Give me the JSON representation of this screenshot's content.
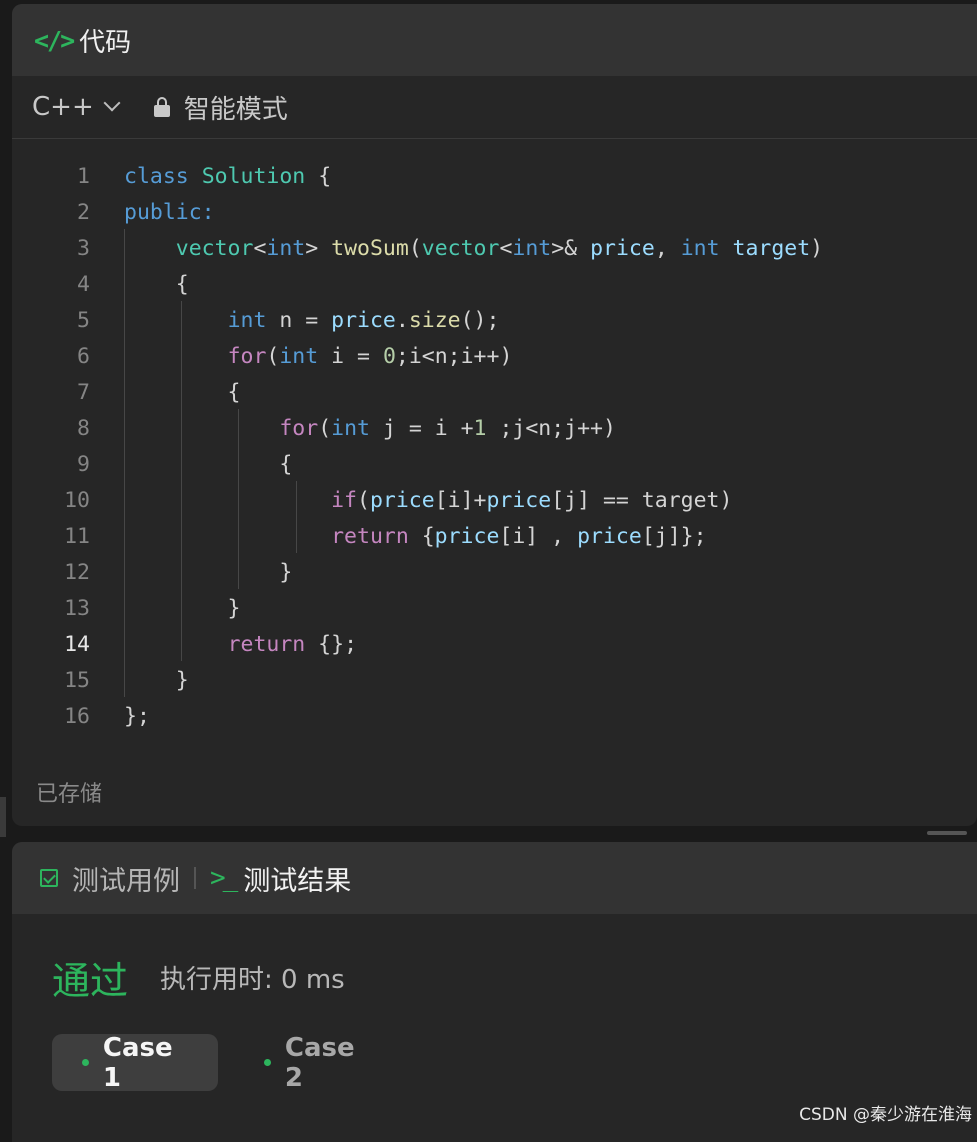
{
  "code_panel": {
    "icon": "code-icon",
    "icon_glyph": "</>",
    "title": "代码",
    "language": "C++",
    "mode": "智能模式",
    "saved_status": "已存储",
    "active_line": 14,
    "lines": [
      {
        "num": "1",
        "tokens": [
          [
            "k",
            "class"
          ],
          [
            "p",
            " "
          ],
          [
            "t",
            "Solution"
          ],
          [
            "p",
            " {"
          ]
        ]
      },
      {
        "num": "2",
        "tokens": [
          [
            "k",
            "public"
          ],
          [
            "k",
            ":"
          ]
        ]
      },
      {
        "num": "3",
        "tokens": [
          [
            "p",
            "    "
          ],
          [
            "t",
            "vector"
          ],
          [
            "p",
            "<"
          ],
          [
            "k",
            "int"
          ],
          [
            "p",
            "> "
          ],
          [
            "f",
            "twoSum"
          ],
          [
            "p",
            "("
          ],
          [
            "t",
            "vector"
          ],
          [
            "p",
            "<"
          ],
          [
            "k",
            "int"
          ],
          [
            "p",
            ">& "
          ],
          [
            "v",
            "price"
          ],
          [
            "p",
            ", "
          ],
          [
            "k",
            "int"
          ],
          [
            "p",
            " "
          ],
          [
            "v",
            "target"
          ],
          [
            "p",
            ")"
          ]
        ]
      },
      {
        "num": "4",
        "tokens": [
          [
            "p",
            "    {"
          ]
        ]
      },
      {
        "num": "5",
        "tokens": [
          [
            "p",
            "        "
          ],
          [
            "k",
            "int"
          ],
          [
            "p",
            " n = "
          ],
          [
            "v",
            "price"
          ],
          [
            "p",
            "."
          ],
          [
            "f",
            "size"
          ],
          [
            "p",
            "();"
          ]
        ]
      },
      {
        "num": "6",
        "tokens": [
          [
            "p",
            "        "
          ],
          [
            "c",
            "for"
          ],
          [
            "p",
            "("
          ],
          [
            "k",
            "int"
          ],
          [
            "p",
            " i = "
          ],
          [
            "n",
            "0"
          ],
          [
            "p",
            ";i<n;i++)"
          ]
        ]
      },
      {
        "num": "7",
        "tokens": [
          [
            "p",
            "        {"
          ]
        ]
      },
      {
        "num": "8",
        "tokens": [
          [
            "p",
            "            "
          ],
          [
            "c",
            "for"
          ],
          [
            "p",
            "("
          ],
          [
            "k",
            "int"
          ],
          [
            "p",
            " j = i +"
          ],
          [
            "n",
            "1"
          ],
          [
            "p",
            " ;j<n;j++)"
          ]
        ]
      },
      {
        "num": "9",
        "tokens": [
          [
            "p",
            "            {"
          ]
        ]
      },
      {
        "num": "10",
        "tokens": [
          [
            "p",
            "                "
          ],
          [
            "c",
            "if"
          ],
          [
            "p",
            "("
          ],
          [
            "v",
            "price"
          ],
          [
            "p",
            "[i]+"
          ],
          [
            "v",
            "price"
          ],
          [
            "p",
            "[j] == target)"
          ]
        ]
      },
      {
        "num": "11",
        "tokens": [
          [
            "p",
            "                "
          ],
          [
            "c",
            "return"
          ],
          [
            "p",
            " {"
          ],
          [
            "v",
            "price"
          ],
          [
            "p",
            "[i] , "
          ],
          [
            "v",
            "price"
          ],
          [
            "p",
            "[j]};"
          ]
        ]
      },
      {
        "num": "12",
        "tokens": [
          [
            "p",
            "            }"
          ]
        ]
      },
      {
        "num": "13",
        "tokens": [
          [
            "p",
            "        }"
          ]
        ]
      },
      {
        "num": "14",
        "tokens": [
          [
            "p",
            "        "
          ],
          [
            "c",
            "return"
          ],
          [
            "p",
            " {};"
          ]
        ]
      },
      {
        "num": "15",
        "tokens": [
          [
            "p",
            "    }"
          ]
        ]
      },
      {
        "num": "16",
        "tokens": [
          [
            "p",
            "};"
          ]
        ]
      }
    ]
  },
  "result_panel": {
    "tab_testcase": "测试用例",
    "tab_testcase_icon": "checkbox-icon",
    "tab_result": "测试结果",
    "tab_result_icon": "terminal-icon",
    "tab_result_glyph": ">_",
    "status": "通过",
    "runtime": "执行用时: 0 ms",
    "cases": [
      "Case 1",
      "Case 2"
    ]
  },
  "watermark": "CSDN @秦少游在淮海",
  "colors": {
    "accent_green": "#2db55d",
    "keyword_blue": "#569cd6",
    "control_purple": "#c586c0",
    "type_teal": "#4ec9b0",
    "function_yellow": "#dcdcaa",
    "variable_lightblue": "#9cdcfe"
  }
}
